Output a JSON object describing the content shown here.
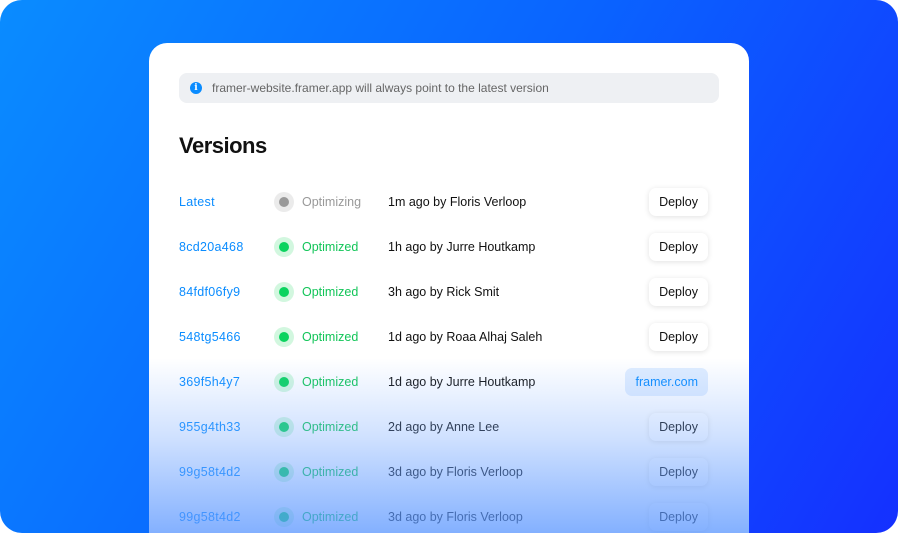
{
  "info": {
    "icon": "info-icon",
    "text": "framer-website.framer.app will always point to the latest version"
  },
  "title": "Versions",
  "versions": [
    {
      "id": "Latest",
      "status": "Optimizing",
      "desc": "1m ago by Floris Verloop",
      "action": "Deploy"
    },
    {
      "id": "8cd20a468",
      "status": "Optimized",
      "desc": "1h ago by Jurre Houtkamp",
      "action": "Deploy"
    },
    {
      "id": "84fdf06fy9",
      "status": "Optimized",
      "desc": "3h ago by Rick Smit",
      "action": "Deploy"
    },
    {
      "id": "548tg5466",
      "status": "Optimized",
      "desc": "1d ago by Roaa Alhaj Saleh",
      "action": "Deploy"
    },
    {
      "id": "369f5h4y7",
      "status": "Optimized",
      "desc": "1d ago by Jurre Houtkamp",
      "action": "framer.com"
    },
    {
      "id": "955g4th33",
      "status": "Optimized",
      "desc": "2d ago by Anne Lee",
      "action": "Deploy"
    },
    {
      "id": "99g58t4d2",
      "status": "Optimized",
      "desc": "3d ago by Floris Verloop",
      "action": "Deploy"
    },
    {
      "id": "99g58t4d2",
      "status": "Optimized",
      "desc": "3d ago by Floris Verloop",
      "action": "Deploy"
    }
  ]
}
